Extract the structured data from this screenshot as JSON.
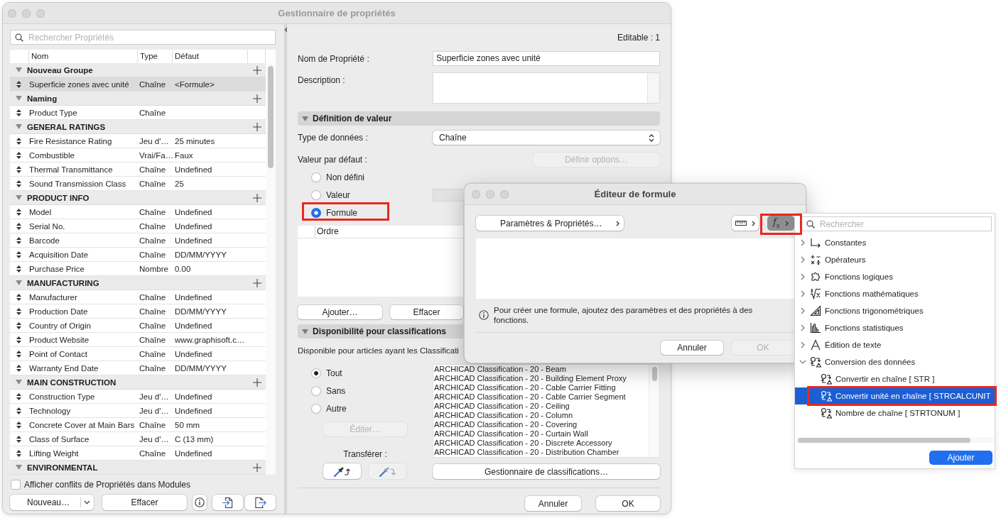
{
  "properties_window": {
    "title": "Gestionnaire de propriétés",
    "search": {
      "placeholder": "Rechercher Propriétés"
    },
    "columns": [
      "Nom",
      "Type",
      "Défaut"
    ],
    "groups": [
      {
        "name": "Nouveau Groupe",
        "expanded": true,
        "items": [
          {
            "name": "Superficie zones avec unité",
            "type": "Chaîne",
            "default": "<Formule>",
            "selected": true
          }
        ]
      },
      {
        "name": "Naming",
        "expanded": true,
        "items": [
          {
            "name": "Product Type",
            "type": "Chaîne",
            "selected": false
          }
        ]
      },
      {
        "name": "GENERAL RATINGS",
        "expanded": true,
        "items": [
          {
            "name": "Fire Resistance Rating",
            "type": "Jeu d'…",
            "default": "25 minutes",
            "selected": false
          },
          {
            "name": "Combustible",
            "type": "Vrai/Fa…",
            "default": "Faux",
            "selected": false
          },
          {
            "name": "Thermal Transmittance",
            "type": "Chaîne",
            "default": "Undefined",
            "selected": false
          },
          {
            "name": "Sound Transmission Class",
            "type": "Chaîne",
            "default": "25",
            "selected": false
          }
        ]
      },
      {
        "name": "PRODUCT INFO",
        "expanded": true,
        "items": [
          {
            "name": "Model",
            "type": "Chaîne",
            "default": "Undefined",
            "selected": false
          },
          {
            "name": "Serial No.",
            "type": "Chaîne",
            "default": "Undefined",
            "selected": false
          },
          {
            "name": "Barcode",
            "type": "Chaîne",
            "default": "Undefined",
            "selected": false
          },
          {
            "name": "Acquisition Date",
            "type": "Chaîne",
            "default": "DD/MM/YYYY",
            "selected": false
          },
          {
            "name": "Purchase Price",
            "type": "Nombre",
            "default": "0.00",
            "selected": false
          }
        ]
      },
      {
        "name": "MANUFACTURING",
        "expanded": true,
        "items": [
          {
            "name": "Manufacturer",
            "type": "Chaîne",
            "default": "Undefined",
            "selected": false
          },
          {
            "name": "Production Date",
            "type": "Chaîne",
            "default": "DD/MM/YYYY",
            "selected": false
          },
          {
            "name": "Country of Origin",
            "type": "Chaîne",
            "default": "Undefined",
            "selected": false
          },
          {
            "name": "Product Website",
            "type": "Chaîne",
            "default": "www.graphisoft.c…",
            "selected": false
          },
          {
            "name": "Point of Contact",
            "type": "Chaîne",
            "default": "Undefined",
            "selected": false
          },
          {
            "name": "Warranty End Date",
            "type": "Chaîne",
            "default": "DD/MM/YYYY",
            "selected": false
          }
        ]
      },
      {
        "name": "MAIN CONSTRUCTION",
        "expanded": true,
        "items": [
          {
            "name": "Construction Type",
            "type": "Jeu d'…",
            "default": "Undefined",
            "selected": false
          },
          {
            "name": "Technology",
            "type": "Jeu d'…",
            "default": "Undefined",
            "selected": false
          },
          {
            "name": "Concrete Cover at Main Bars",
            "type": "Chaîne",
            "default": "50 mm",
            "selected": false
          },
          {
            "name": "Class of Surface",
            "type": "Jeu d'…",
            "default": "C (13 mm)",
            "selected": false
          },
          {
            "name": "Lifting Weight",
            "type": "Chaîne",
            "default": "Undefined",
            "selected": false
          }
        ]
      },
      {
        "name": "ENVIRONMENTAL",
        "expanded": true
      }
    ],
    "show_conflicts": {
      "label": "Afficher conflits de Propriétés dans Modules",
      "checked": false
    },
    "new_button": "Nouveau…",
    "delete_button": "Effacer",
    "editable": "Editable : 1",
    "name_field": {
      "label": "Nom de Propriété :",
      "value": "Superficie zones avec unité"
    },
    "description_field": {
      "label": "Description :"
    },
    "value_definition": {
      "title": "Définition de valeur",
      "expanded": true,
      "data_type": {
        "label": "Type de données :",
        "value": "Chaîne"
      },
      "default_label": "Valeur par défaut :",
      "options_button": {
        "label": "Définir options…",
        "disabled": true
      },
      "modes": [
        {
          "kind": "none",
          "label": "Non défini",
          "selected": false,
          "highlighted": false
        },
        {
          "kind": "value",
          "label": "Valeur",
          "selected": false,
          "highlighted": false
        },
        {
          "kind": "formula",
          "label": "Formule",
          "selected": true,
          "highlighted": true
        }
      ],
      "order_column": "Ordre",
      "buttons": [
        {
          "label": "Ajouter…",
          "disabled": false
        },
        {
          "label": "Effacer",
          "disabled": false
        }
      ]
    },
    "classification_availability": {
      "title": "Disponibilité pour classifications",
      "expanded": true,
      "intro": "Disponible pour articles ayant les Classificati",
      "scope": [
        {
          "label": "Tout",
          "selected": true
        },
        {
          "label": "Sans",
          "selected": false
        },
        {
          "label": "Autre",
          "selected": false
        }
      ],
      "edit_button": {
        "label": "Éditer…",
        "disabled": true
      },
      "classifications": [
        "ARCHICAD Classification - 20 - Beam",
        "ARCHICAD Classification - 20 - Building Element Proxy",
        "ARCHICAD Classification - 20 - Cable Carrier Fitting",
        "ARCHICAD Classification - 20 - Cable Carrier Segment",
        "ARCHICAD Classification - 20 - Ceiling",
        "ARCHICAD Classification - 20 - Column",
        "ARCHICAD Classification - 20 - Covering",
        "ARCHICAD Classification - 20 - Curtain Wall",
        "ARCHICAD Classification - 20 - Discrete Accessory",
        "ARCHICAD Classification - 20 - Distribution Chamber"
      ],
      "transfer_label": "Transférer :",
      "transfer_buttons": [
        {
          "kind": "pick",
          "disabled": false
        },
        {
          "kind": "apply",
          "disabled": true
        }
      ],
      "manager_button": "Gestionnaire de classifications…"
    },
    "footer_buttons": [
      {
        "label": "Annuler",
        "disabled": false
      },
      {
        "label": "OK",
        "disabled": false
      }
    ]
  },
  "formula_editor": {
    "title": "Éditeur de formule",
    "toolbar": [
      {
        "kind": "parameters",
        "label": "Paramètres & Propriétés…",
        "pressed": false,
        "highlighted": false
      },
      {
        "kind": "units",
        "pressed": false,
        "highlighted": false
      },
      {
        "kind": "functions",
        "symbol": "f$_{x}$",
        "pressed": true,
        "highlighted": true
      }
    ],
    "hint": "Pour créer une formule, ajoutez des paramètres et des propriétés à des fonctions.",
    "buttons": [
      {
        "label": "Annuler",
        "disabled": false
      },
      {
        "label": "OK",
        "disabled": true
      }
    ]
  },
  "function_picker": {
    "search": {
      "placeholder": "Rechercher"
    },
    "tree": [
      {
        "kind": "constants",
        "label": "Constantes",
        "expanded": false,
        "selected": false,
        "highlighted": false
      },
      {
        "kind": "operators",
        "label": "Opérateurs",
        "expanded": false,
        "selected": false,
        "highlighted": false
      },
      {
        "kind": "logic",
        "label": "Fonctions logiques",
        "expanded": false,
        "selected": false,
        "highlighted": false
      },
      {
        "kind": "math",
        "label": "Fonctions mathématiques",
        "expanded": false,
        "selected": false,
        "highlighted": false
      },
      {
        "kind": "trig",
        "label": "Fonctions trigonométriques",
        "expanded": false,
        "selected": false,
        "highlighted": false
      },
      {
        "kind": "stats",
        "label": "Fonctions statistiques",
        "expanded": false,
        "selected": false,
        "highlighted": false
      },
      {
        "kind": "text",
        "label": "Édition de texte",
        "expanded": false,
        "selected": false,
        "highlighted": false
      },
      {
        "kind": "conversion",
        "label": "Conversion des données",
        "expanded": true,
        "selected": false,
        "highlighted": false,
        "children": [
          {
            "kind": "conversion",
            "label": "Convertir en chaîne [ STR ]",
            "selected": false,
            "highlighted": false
          },
          {
            "kind": "conversion",
            "label": "Convertir unité en chaîne [ STRCALCUNIT",
            "selected": true,
            "highlighted": true
          },
          {
            "kind": "conversion",
            "label": "Nombre de chaîne [ STRTONUM ]",
            "selected": false,
            "highlighted": false
          }
        ]
      }
    ],
    "add_button": "Ajouter"
  }
}
